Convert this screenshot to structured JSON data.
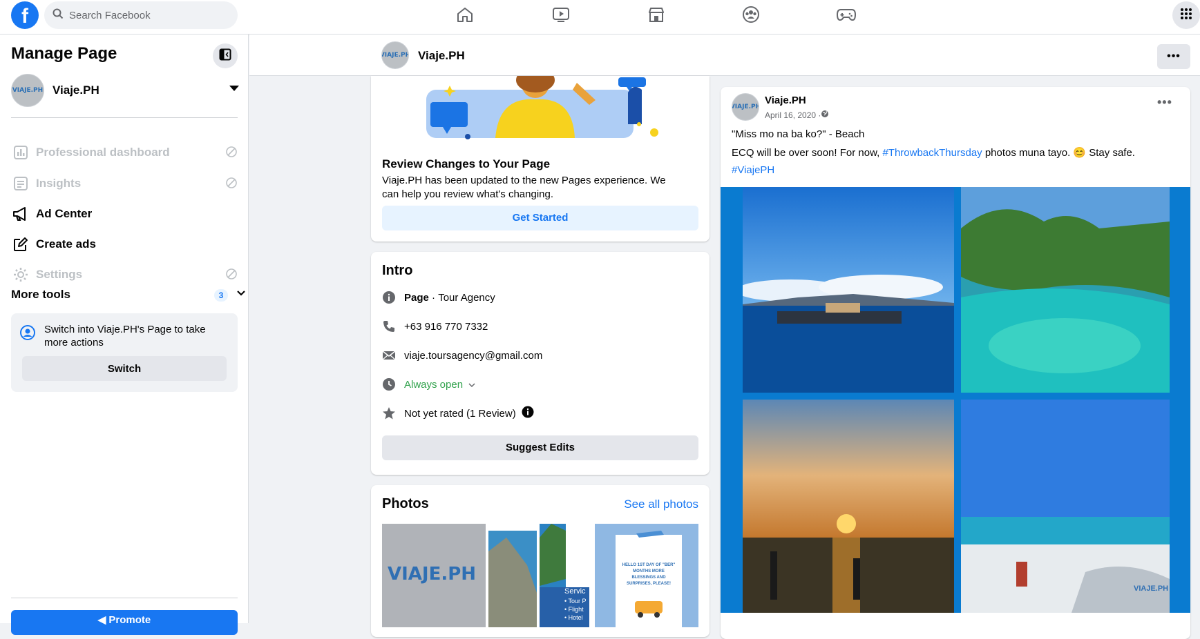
{
  "topbar": {
    "logo": "f",
    "search_placeholder": "Search Facebook",
    "nav_icons": [
      "home-icon",
      "watch-icon",
      "marketplace-icon",
      "groups-icon",
      "gaming-icon"
    ]
  },
  "sidebar": {
    "title": "Manage Page",
    "page_name": "Viaje.PH",
    "items": [
      {
        "label": "Professional dashboard",
        "disabled": true
      },
      {
        "label": "Insights",
        "disabled": true
      },
      {
        "label": "Ad Center",
        "disabled": false
      },
      {
        "label": "Create ads",
        "disabled": false
      },
      {
        "label": "Settings",
        "disabled": true
      }
    ],
    "more_tools": "More tools",
    "more_tools_count": "3",
    "switch_text": "Switch into Viaje.PH's Page to take more actions",
    "switch_button": "Switch",
    "promote_button": "Promote"
  },
  "header": {
    "page_name": "Viaje.PH",
    "more_label": "•••"
  },
  "review": {
    "title": "Review Changes to Your Page",
    "description": "Viaje.PH has been updated to the new Pages experience. We can help you review what's changing.",
    "button": "Get Started"
  },
  "intro": {
    "title": "Intro",
    "category_label": "Page",
    "category_value": "Tour Agency",
    "phone": "+63 916 770 7332",
    "email": "viaje.toursagency@gmail.com",
    "hours": "Always open",
    "rating": "Not yet rated (1 Review)",
    "button": "Suggest Edits"
  },
  "photos": {
    "title": "Photos",
    "see_all": "See all photos",
    "logo_text": "VIAJE.PH",
    "thumb2_text": "Servic",
    "thumb2_list": [
      "• Tour P",
      "• Flight",
      "• Hotel"
    ],
    "thumb3_text": "HELLO 1ST DAY OF \"BER\" MONTHS MORE BLESSINGS AND SURPRISES, PLEASE!"
  },
  "post": {
    "author": "Viaje.PH",
    "date": "April 16, 2020 · ",
    "line1": "\"Miss mo na ba ko?\" - Beach",
    "line2_a": "ECQ will be over soon! For now, ",
    "line2_link": "#ThrowbackThursday",
    "line2_b": " photos muna tayo. 😊 Stay safe.",
    "hashtag": "#ViajePH",
    "watermark": "VIAJE.PH"
  },
  "colors": {
    "brand_blue": "#1877f2",
    "green": "#31a24c",
    "bg": "#f0f2f5"
  }
}
